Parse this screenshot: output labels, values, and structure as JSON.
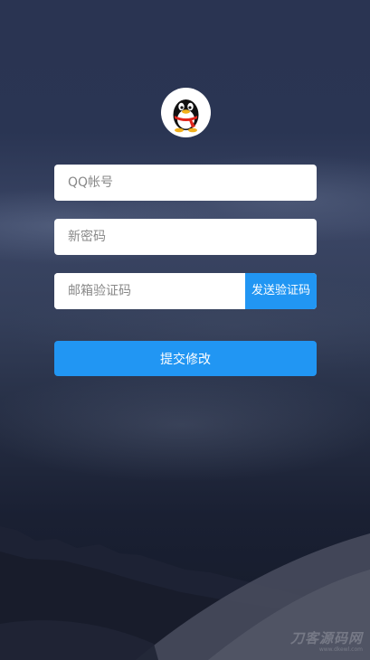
{
  "form": {
    "qq_placeholder": "QQ帐号",
    "qq_value": "",
    "password_placeholder": "新密码",
    "password_value": "",
    "code_placeholder": "邮箱验证码",
    "code_value": "",
    "send_code_label": "发送验证码",
    "submit_label": "提交修改"
  },
  "avatar": {
    "icon": "qq-penguin-icon"
  },
  "watermark": {
    "title": "刀客源码网",
    "url": "www.dkewl.com"
  },
  "colors": {
    "accent": "#2196f3",
    "field_bg": "#ffffff",
    "sky_top": "#2a3452",
    "ground": "#141a28"
  }
}
